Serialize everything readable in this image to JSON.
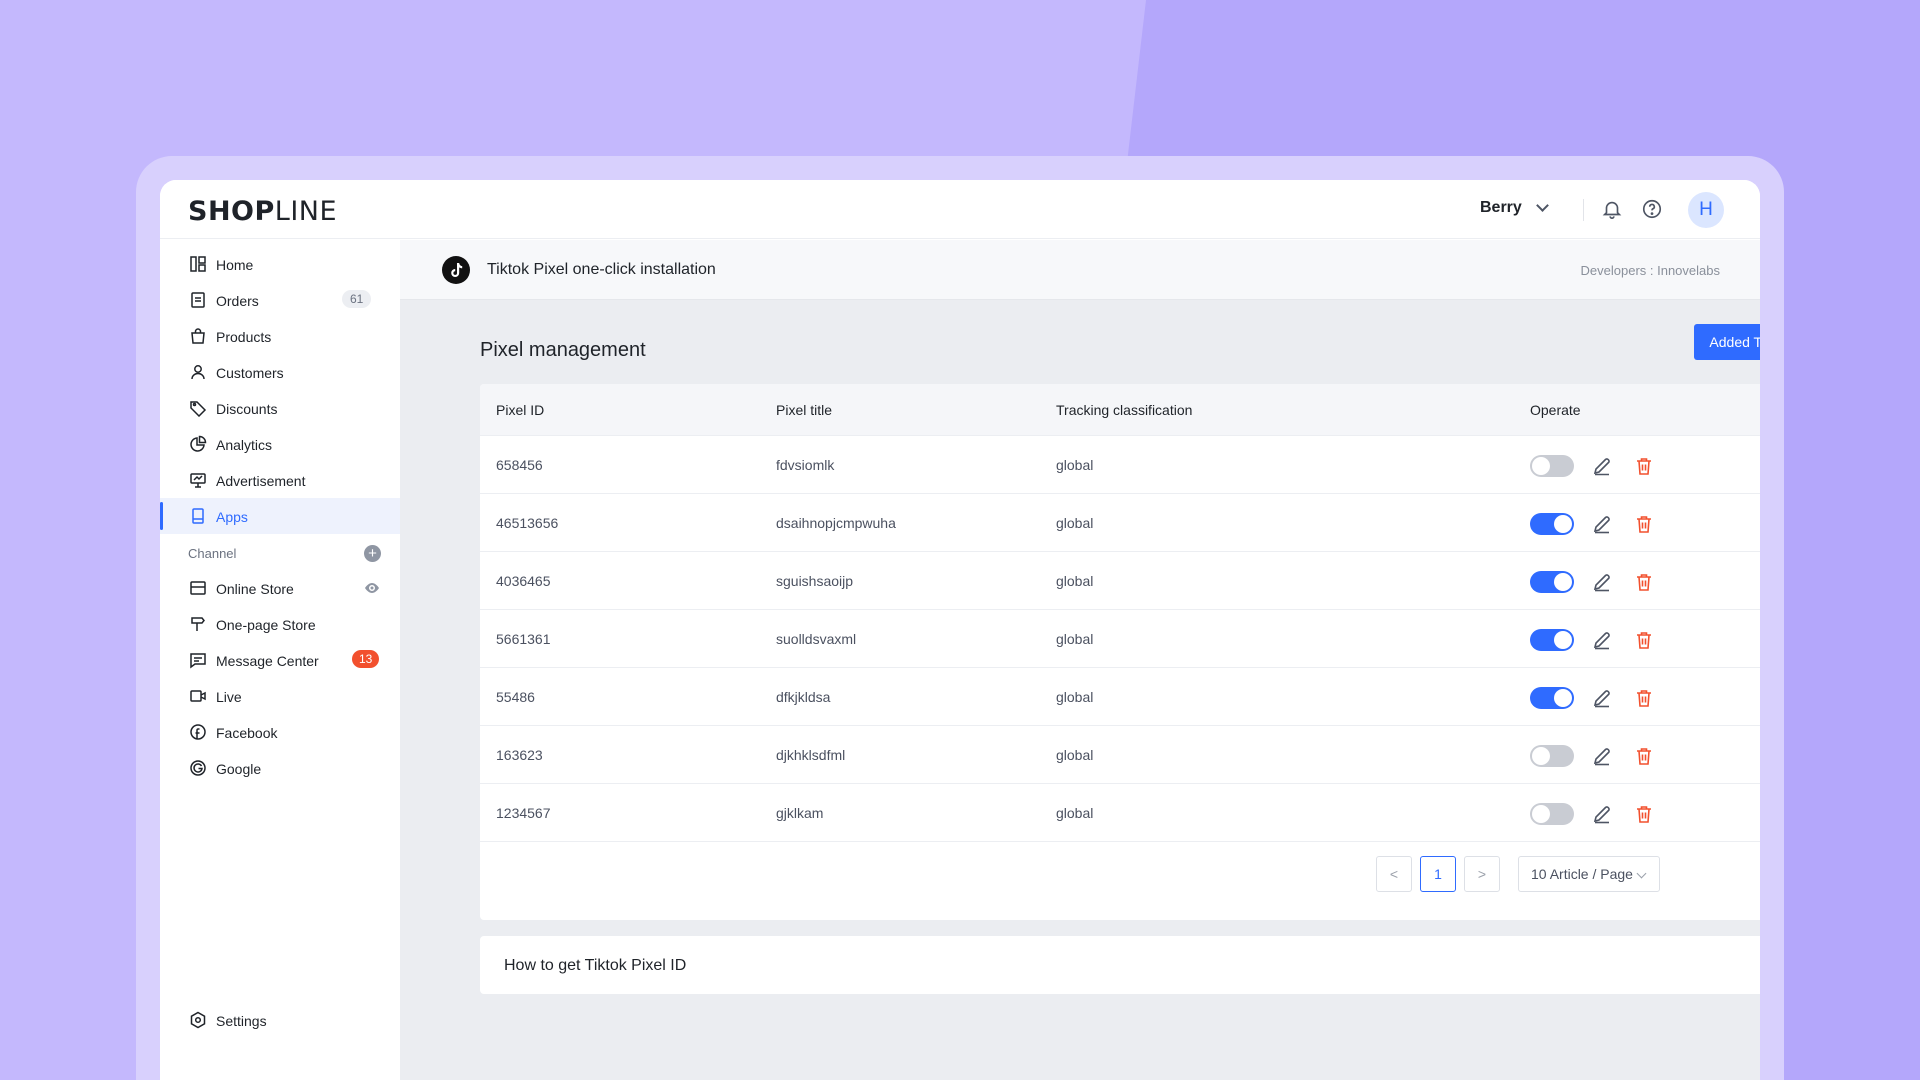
{
  "brand": {
    "logo_bold": "SHOP",
    "logo_light": "LINE"
  },
  "header": {
    "user_name": "Berry",
    "avatar_letter": "H"
  },
  "sidebar": {
    "items": [
      {
        "label": "Home"
      },
      {
        "label": "Orders",
        "badge": "61"
      },
      {
        "label": "Products"
      },
      {
        "label": "Customers"
      },
      {
        "label": "Discounts"
      },
      {
        "label": "Analytics"
      },
      {
        "label": "Advertisement"
      },
      {
        "label": "Apps",
        "active": true
      }
    ],
    "channel_label": "Channel",
    "channel_add": "+",
    "channel_items": [
      {
        "label": "Online Store"
      },
      {
        "label": "One-page Store"
      },
      {
        "label": "Message Center",
        "badge": "13"
      },
      {
        "label": "Live"
      },
      {
        "label": "Facebook"
      },
      {
        "label": "Google"
      }
    ],
    "settings_label": "Settings"
  },
  "app_bar": {
    "title": "Tiktok Pixel one-click installation",
    "developer": "Developers : Innovelabs"
  },
  "main": {
    "page_title": "Pixel management",
    "add_button": "Added Tiktok Pixel",
    "table": {
      "headers": [
        "Pixel ID",
        "Pixel title",
        "Tracking classification",
        "Operate"
      ],
      "rows": [
        {
          "id": "658456",
          "title": "fdvsiomlk",
          "classification": "global",
          "enabled": false
        },
        {
          "id": "46513656",
          "title": "dsaihnopjcmpwuha",
          "classification": "global",
          "enabled": true
        },
        {
          "id": "4036465",
          "title": "sguishsaoijp",
          "classification": "global",
          "enabled": true
        },
        {
          "id": "5661361",
          "title": "suolldsvaxml",
          "classification": "global",
          "enabled": true
        },
        {
          "id": "55486",
          "title": "dfkjkldsa",
          "classification": "global",
          "enabled": true
        },
        {
          "id": "163623",
          "title": "djkhklsdfml",
          "classification": "global",
          "enabled": false
        },
        {
          "id": "1234567",
          "title": "gjklkam",
          "classification": "global",
          "enabled": false
        }
      ]
    },
    "pagination": {
      "prev": "<",
      "current": "1",
      "next": ">",
      "page_size": "10 Article / Page"
    },
    "faq_title": "How to get Tiktok Pixel ID"
  },
  "colors": {
    "accent": "#2f6bff",
    "danger": "#f2502e",
    "background": "#c4b8fd"
  }
}
